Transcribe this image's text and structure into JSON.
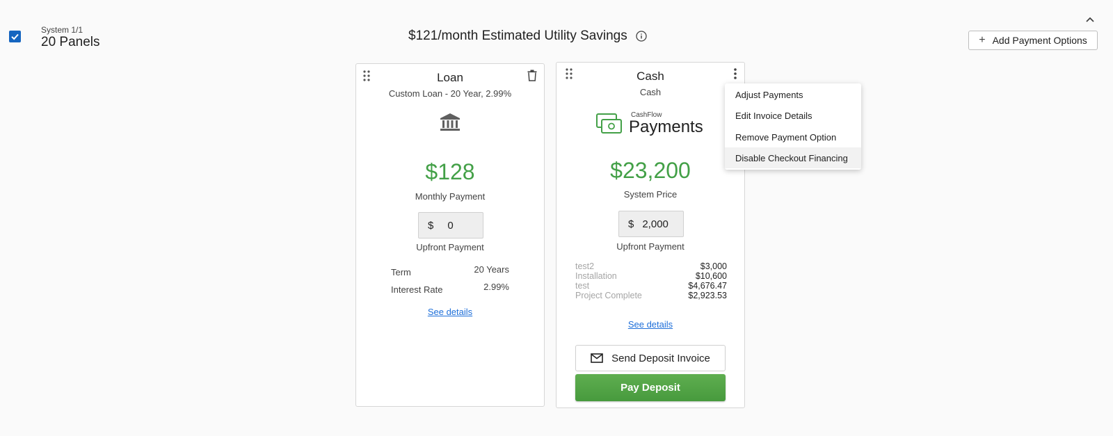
{
  "header": {
    "system_label": "System 1/1",
    "panels_label": "20 Panels",
    "savings_text": "$121/month Estimated Utility Savings",
    "add_button_label": "Add Payment Options"
  },
  "loan_card": {
    "title": "Loan",
    "subtitle": "Custom Loan - 20 Year, 2.99%",
    "amount": "$128",
    "amount_label": "Monthly Payment",
    "currency": "$",
    "upfront_value": "0",
    "upfront_label": "Upfront Payment",
    "details": [
      {
        "label": "Term",
        "value": "20 Years"
      },
      {
        "label": "Interest Rate",
        "value": "2.99%"
      }
    ],
    "link_label": "See details"
  },
  "cash_card": {
    "title": "Cash",
    "subtitle": "Cash",
    "logo_small": "CashFlow",
    "logo_big": "Payments",
    "amount": "$23,200",
    "amount_label": "System Price",
    "currency": "$",
    "upfront_value": "2,000",
    "upfront_label": "Upfront Payment",
    "milestones": [
      {
        "label": "test2",
        "value": "$3,000"
      },
      {
        "label": "Installation",
        "value": "$10,600"
      },
      {
        "label": "test",
        "value": "$4,676.47"
      },
      {
        "label": "Project Complete",
        "value": "$2,923.53"
      }
    ],
    "link_label": "See details",
    "send_button_label": "Send Deposit Invoice",
    "pay_button_label": "Pay Deposit"
  },
  "menu": {
    "items": [
      {
        "label": "Adjust Payments"
      },
      {
        "label": "Edit Invoice Details"
      },
      {
        "label": "Remove Payment Option"
      },
      {
        "label": "Disable Checkout Financing"
      }
    ]
  },
  "colors": {
    "accent_green": "#43a047",
    "checkbox_blue": "#1565c0",
    "link_blue": "#1e6fd9"
  }
}
